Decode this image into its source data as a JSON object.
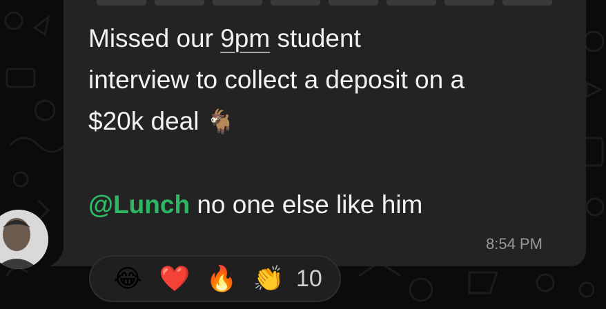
{
  "message": {
    "line1_pre": "Missed our ",
    "line1_link": "9pm",
    "line1_post": " student",
    "line2": "interview to collect a deposit on a",
    "line3": "$20k deal",
    "line3_emoji": "🐐",
    "mention": "@Lunch",
    "line5_post": " no one else like him",
    "time": "8:54 PM"
  },
  "reactions": {
    "items": [
      "😂",
      "❤️",
      "🔥",
      "👏"
    ],
    "count": "10"
  },
  "colors": {
    "mention": "#2fb864",
    "bubble": "#232323",
    "background": "#0b0b0b"
  }
}
